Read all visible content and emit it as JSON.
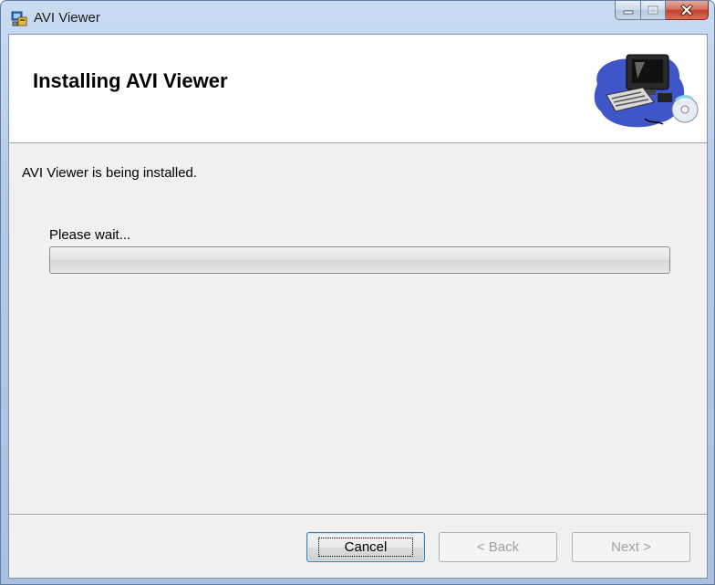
{
  "window": {
    "title": "AVI Viewer",
    "icons": {
      "app": "installer-icon",
      "minimize": "minimize-icon",
      "maximize": "maximize-icon",
      "close": "close-icon"
    }
  },
  "banner": {
    "title": "Installing AVI Viewer",
    "art": "computer-cd-icon"
  },
  "body": {
    "status": "AVI Viewer is being installed.",
    "wait_label": "Please wait...",
    "progress": 0
  },
  "buttons": {
    "cancel": "Cancel",
    "back": "< Back",
    "next": "Next >"
  },
  "colors": {
    "client_bg": "#f0f0f0",
    "frame": "#b6cbe6",
    "close_red": "#c2402b"
  }
}
